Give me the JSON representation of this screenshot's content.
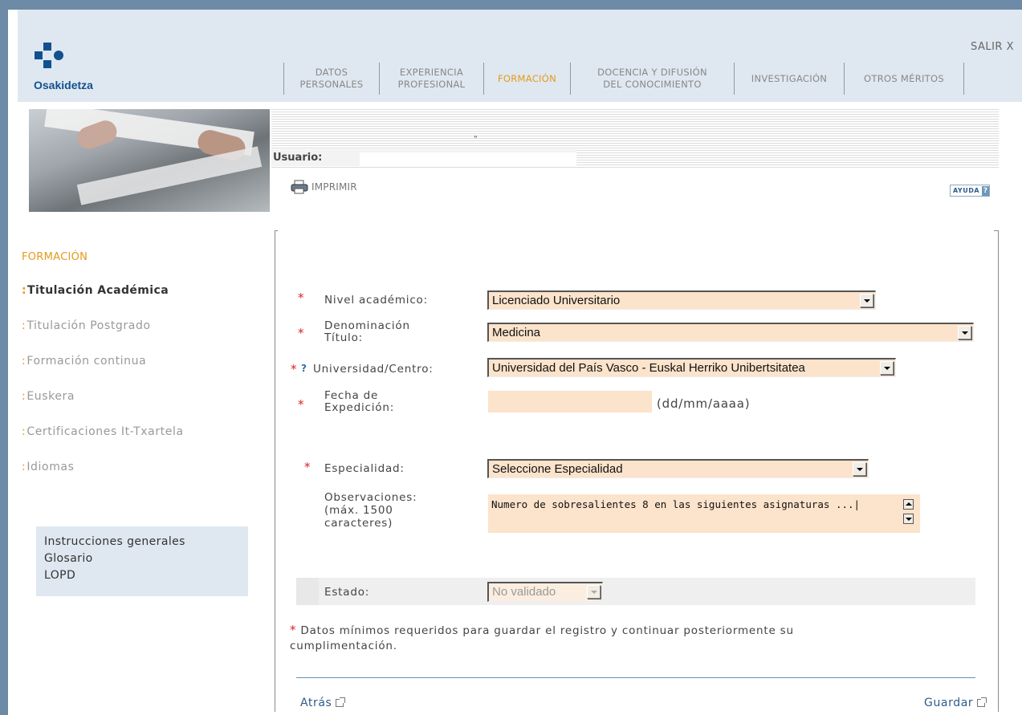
{
  "brand": {
    "name": "Osakidetza"
  },
  "header": {
    "exit_label": "SALIR X"
  },
  "nav": [
    {
      "line1": "DATOS",
      "line2": "PERSONALES"
    },
    {
      "line1": "EXPERIENCIA",
      "line2": "PROFESIONAL"
    },
    {
      "line1": "FORMACIÓN",
      "line2": ""
    },
    {
      "line1": "DOCENCIA Y DIFUSIÓN",
      "line2": "DEL CONOCIMIENTO"
    },
    {
      "line1": "INVESTIGACIÓN",
      "line2": ""
    },
    {
      "line1": "OTROS MÉRITOS",
      "line2": ""
    }
  ],
  "user": {
    "label": "Usuario:",
    "value": ""
  },
  "toolbar": {
    "print_label": "IMPRIMIR",
    "help_label": "AYUDA",
    "help_icon": "?"
  },
  "sidebar": {
    "section_title": "FORMACIÓN",
    "items": [
      {
        "dots": ":",
        "label": "Titulación Académica"
      },
      {
        "dots": ":",
        "label": "Titulación Postgrado"
      },
      {
        "dots": ":",
        "label": "Formación continua"
      },
      {
        "dots": ":",
        "label": "Euskera"
      },
      {
        "dots": ":",
        "label": "Certificaciones It-Txartela"
      },
      {
        "dots": ":",
        "label": "Idiomas"
      }
    ],
    "links": [
      "Instrucciones generales",
      "Glosario",
      "LOPD"
    ]
  },
  "form": {
    "required_mark": "*",
    "help_mark": "?",
    "nivel": {
      "label": "Nivel académico:",
      "value": "Licenciado Universitario"
    },
    "denominacion": {
      "label_line1": "Denominación",
      "label_line2": "Título:",
      "value": "Medicina"
    },
    "universidad": {
      "label": "Universidad/Centro:",
      "value": "Universidad del País Vasco - Euskal Herriko Unibertsitatea"
    },
    "fecha": {
      "label_line1": "Fecha de",
      "label_line2": "Expedición:",
      "value": "",
      "hint": "(dd/mm/aaaa)"
    },
    "especialidad": {
      "label": "Especialidad:",
      "value": "Seleccione Especialidad"
    },
    "observaciones": {
      "label_line1": "Observaciones:",
      "label_line2": "(máx. 1500",
      "label_line3": "caracteres)",
      "value": "Numero de sobresalientes 8 en las siguientes asignaturas ...|"
    },
    "estado": {
      "label": "Estado:",
      "value": "No validado"
    },
    "note_line1": "Datos mínimos requeridos para guardar el registro y continuar posteriormente su",
    "note_line2": "cumplimentación.",
    "back_label": "Atrás",
    "save_label": "Guardar"
  },
  "colors": {
    "accent": "#e49a1a",
    "brand": "#12518f",
    "field_bg": "#fce3cb",
    "header_bg": "#dfe8f0"
  }
}
